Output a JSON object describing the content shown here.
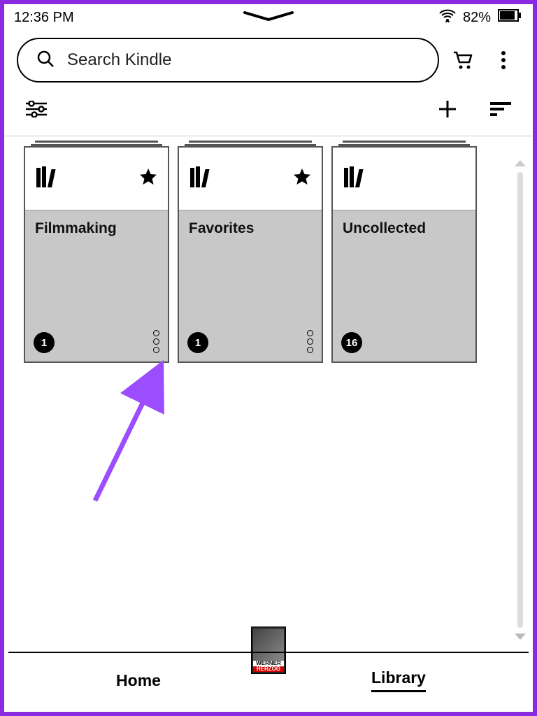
{
  "status": {
    "time": "12:36 PM",
    "battery": "82%"
  },
  "search": {
    "placeholder": "Search Kindle"
  },
  "collections": [
    {
      "title": "Filmmaking",
      "count": "1",
      "starred": true,
      "has_menu": true
    },
    {
      "title": "Favorites",
      "count": "1",
      "starred": true,
      "has_menu": true
    },
    {
      "title": "Uncollected",
      "count": "16",
      "starred": false,
      "has_menu": false
    }
  ],
  "nav": {
    "home": "Home",
    "library": "Library"
  },
  "now_reading": {
    "line1": "WERNER",
    "line2": "HERZOG"
  }
}
